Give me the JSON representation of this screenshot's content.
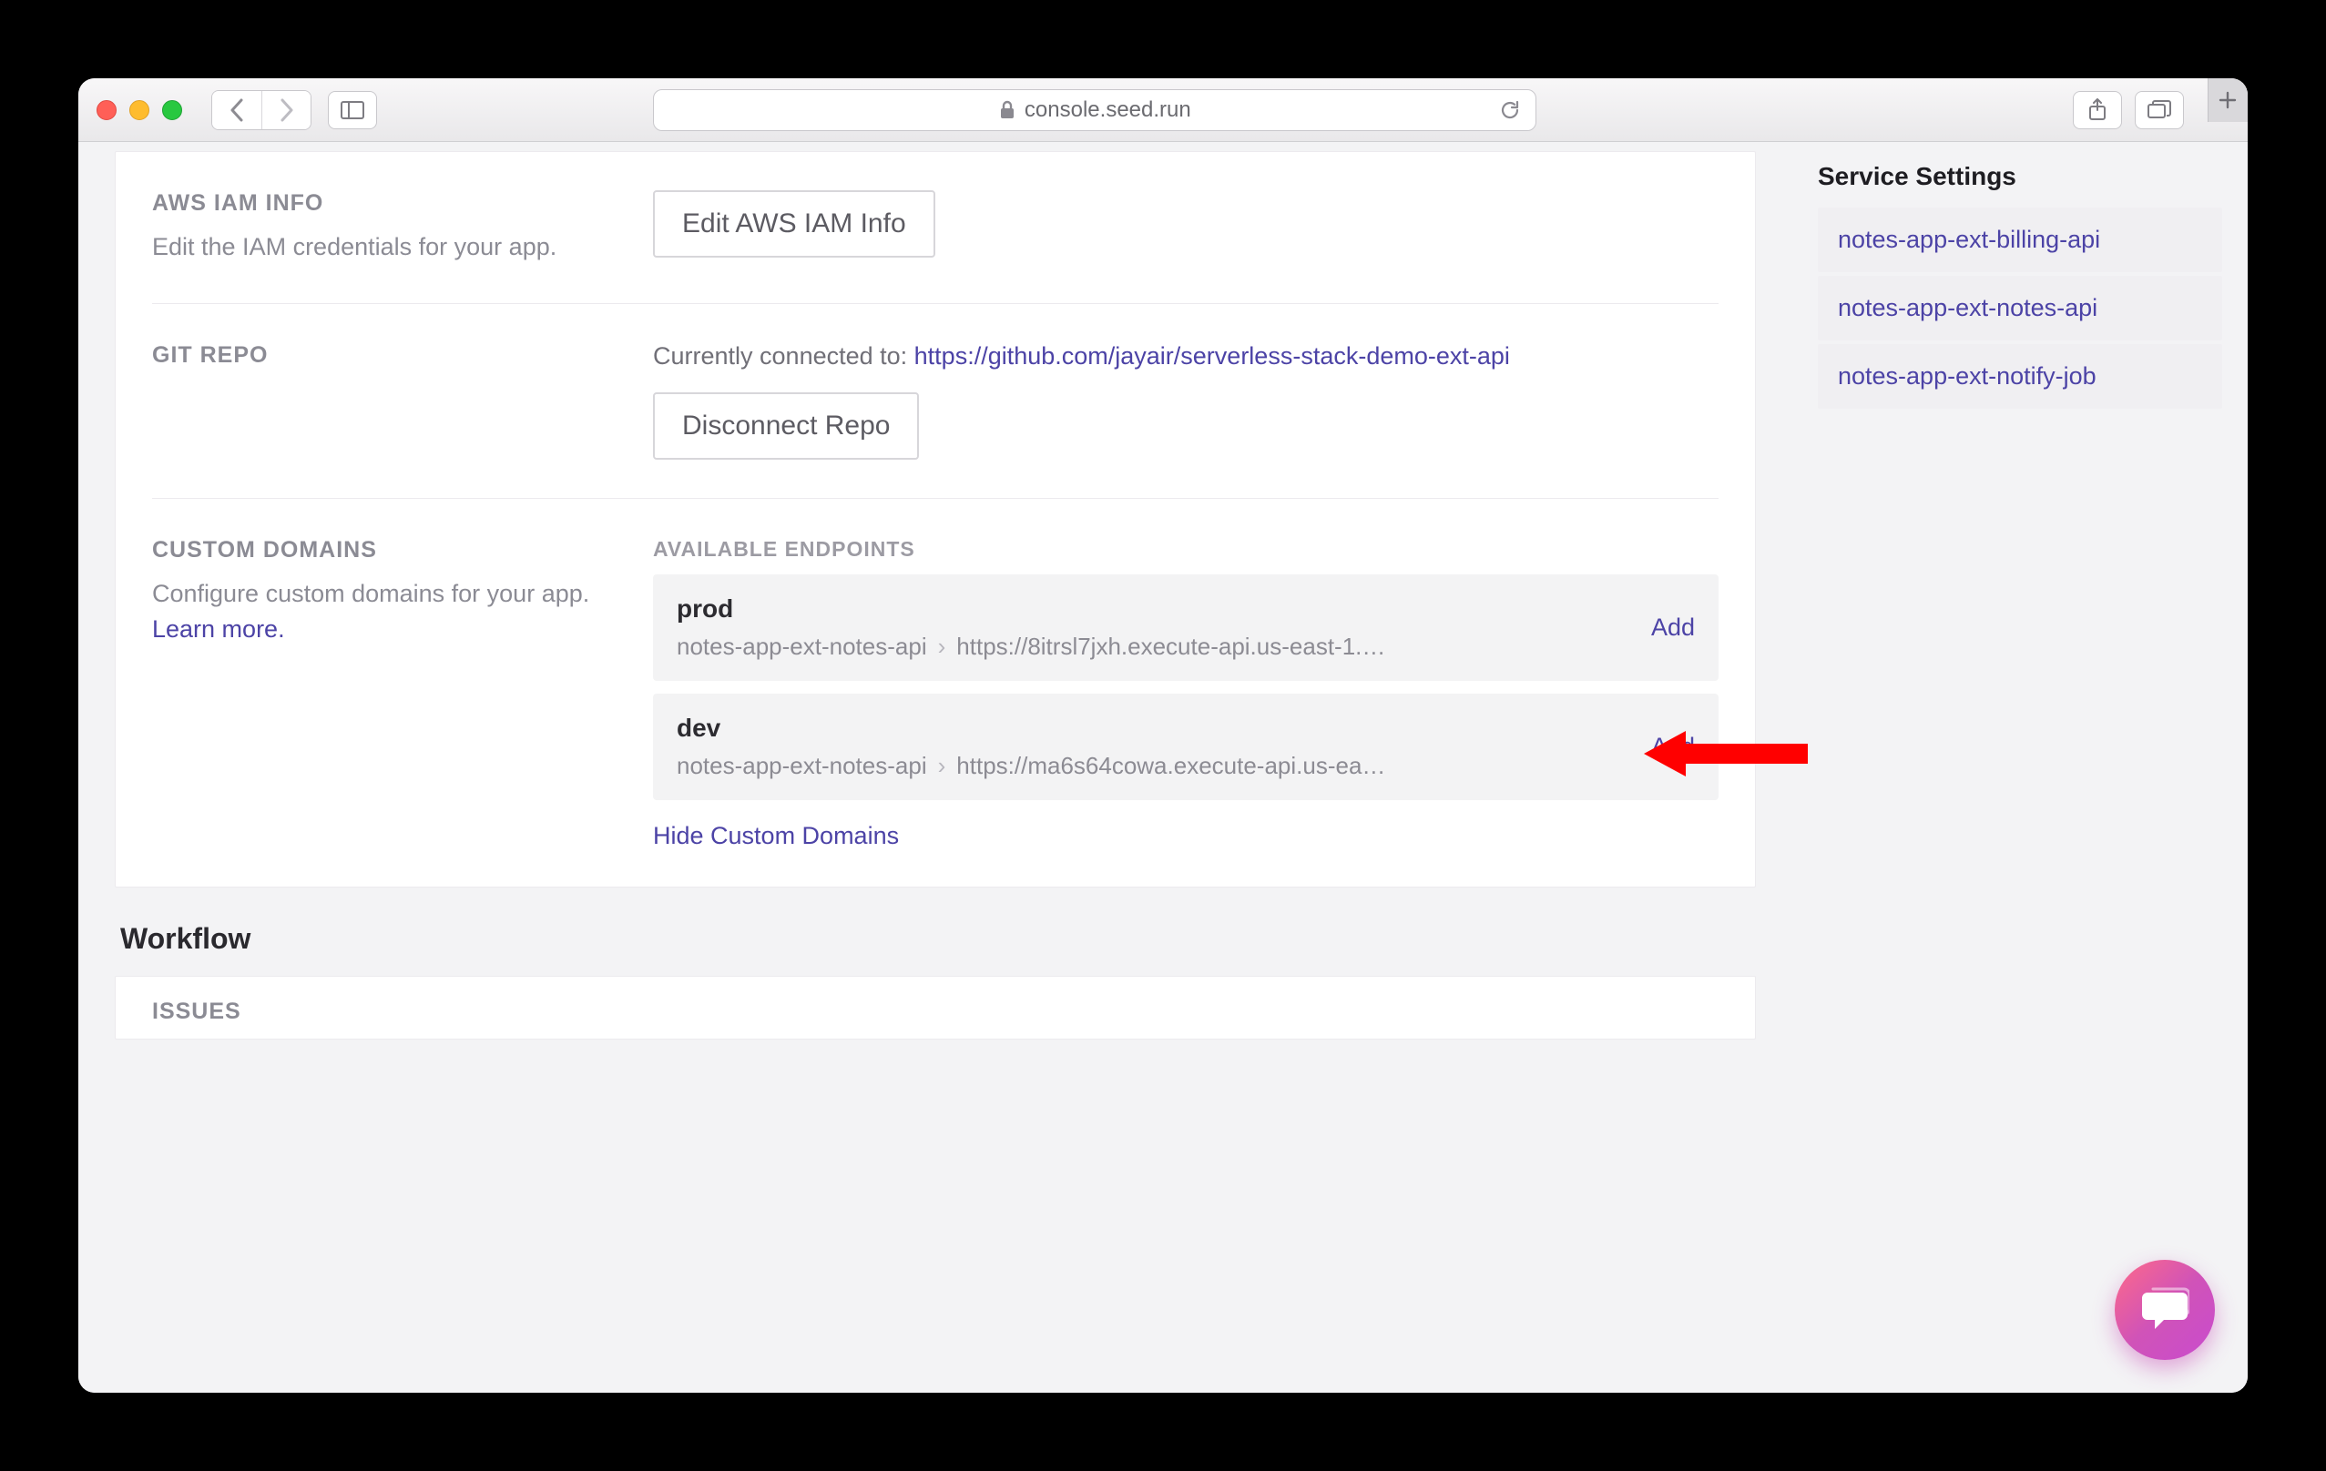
{
  "browser": {
    "url_domain": "console.seed.run"
  },
  "sections": {
    "iam": {
      "title": "AWS IAM INFO",
      "desc": "Edit the IAM credentials for your app.",
      "button": "Edit AWS IAM Info"
    },
    "git": {
      "title": "GIT REPO",
      "connected_prefix": "Currently connected to: ",
      "repo_url": "https://github.com/jayair/serverless-stack-demo-ext-api",
      "button": "Disconnect Repo"
    },
    "domains": {
      "title": "CUSTOM DOMAINS",
      "desc_prefix": "Configure custom domains for your app. ",
      "learn_more": "Learn more.",
      "endpoints_title": "AVAILABLE ENDPOINTS",
      "endpoints": [
        {
          "name": "prod",
          "service": "notes-app-ext-notes-api",
          "url": "https://8itrsl7jxh.execute-api.us-east-1.…",
          "action": "Add"
        },
        {
          "name": "dev",
          "service": "notes-app-ext-notes-api",
          "url": "https://ma6s64cowa.execute-api.us-ea…",
          "action": "Add"
        }
      ],
      "hide": "Hide Custom Domains"
    },
    "issues": {
      "title": "ISSUES"
    }
  },
  "workflow_title": "Workflow",
  "sidebar": {
    "title": "Service Settings",
    "items": [
      "notes-app-ext-billing-api",
      "notes-app-ext-notes-api",
      "notes-app-ext-notify-job"
    ]
  }
}
